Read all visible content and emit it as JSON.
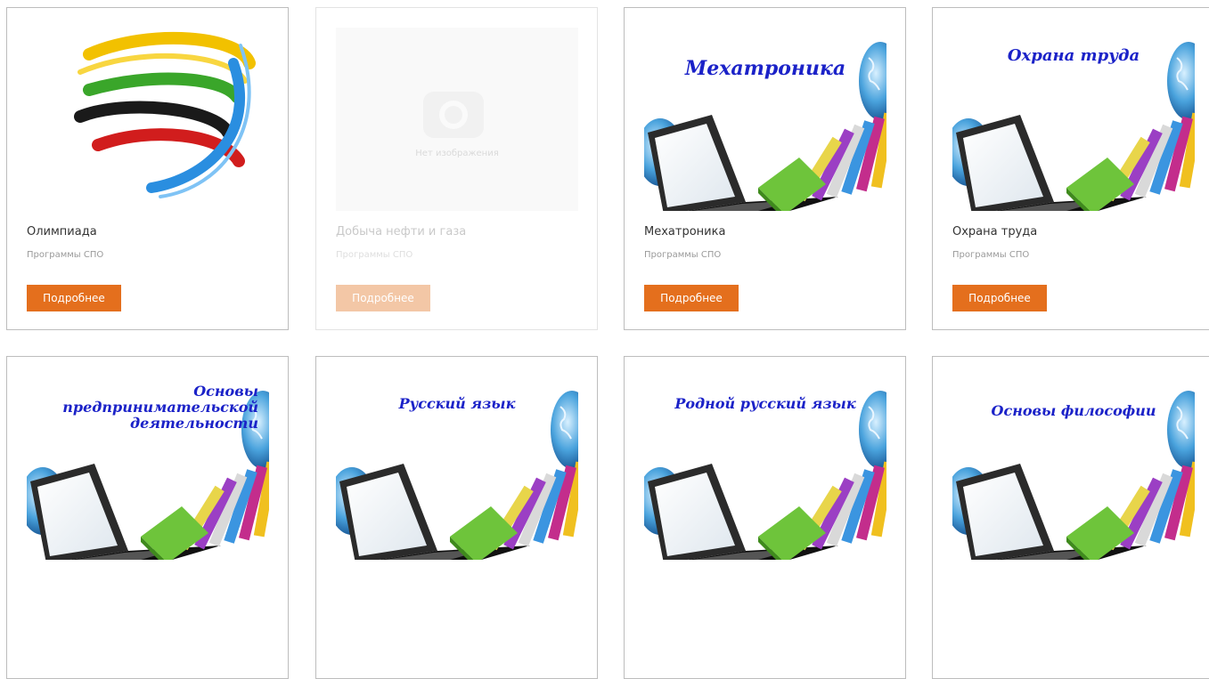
{
  "no_image_text": "Нет изображения",
  "button_label": "Подробнее",
  "cards": [
    {
      "title": "Олимпиада",
      "category": "Программы СПО"
    },
    {
      "title": "Добыча нефти и газа",
      "category": "Программы СПО"
    },
    {
      "title": "Мехатроника",
      "category": "Программы СПО",
      "cover": "Мехатроника"
    },
    {
      "title": "Охрана труда",
      "category": "Программы СПО",
      "cover": "Охрана труда"
    },
    {
      "cover_lines": [
        "Основы",
        "предпринимательской",
        "деятельности"
      ]
    },
    {
      "cover": "Русский язык"
    },
    {
      "cover": "Родной русский язык"
    },
    {
      "cover": "Основы философии"
    }
  ],
  "colors": {
    "button": "#e46f1d",
    "button_faded": "#f3c7a6",
    "cover_text": "#1b22c8"
  }
}
